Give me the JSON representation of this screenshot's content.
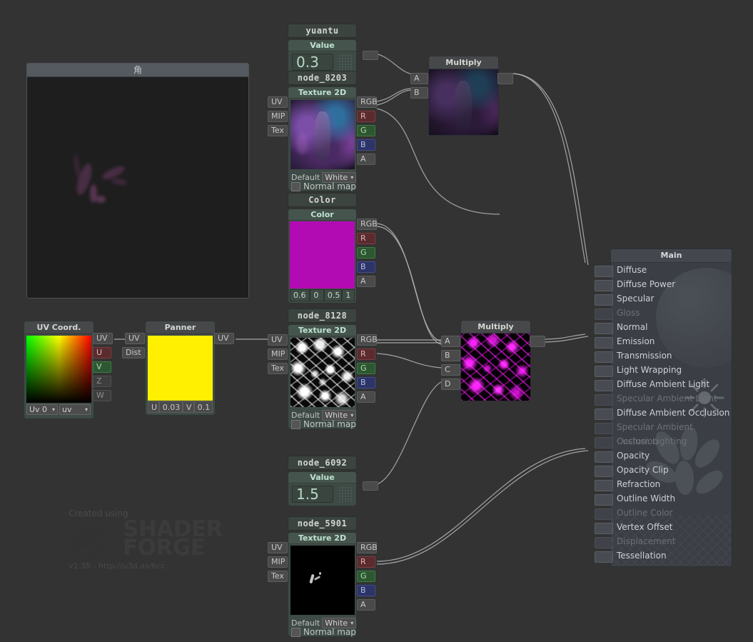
{
  "app": {
    "background": "#333333",
    "watermark": {
      "created_using": "Created using",
      "brand_line1": "SHADER",
      "brand_line2": "FORGE",
      "version": "v1.38 - http://u3d.as/6cc"
    }
  },
  "preview": {
    "title": "角"
  },
  "nodes": {
    "yuantu": {
      "title": "yuantu",
      "header": "Value",
      "value": "0.3"
    },
    "node_8203": {
      "title": "node_8203",
      "header": "Texture 2D",
      "inputs": [
        "UV",
        "MIP",
        "Tex"
      ],
      "outputs": [
        "RGB",
        "R",
        "G",
        "B",
        "A"
      ],
      "default_label": "Default",
      "default_value": "White",
      "normal_map_label": "Normal map"
    },
    "color": {
      "title": "Color",
      "header": "Color",
      "swatch": "#b30bb3",
      "outputs": [
        "RGB",
        "R",
        "G",
        "B",
        "A"
      ],
      "rgba": [
        "0.6",
        "0",
        "0.5",
        "1"
      ]
    },
    "uv_coord": {
      "title": "UV Coord.",
      "outputs": [
        "UV",
        "U",
        "V",
        "Z",
        "W"
      ],
      "select_channel": "Uv 0",
      "select_mode": "uv"
    },
    "panner": {
      "title": "Panner",
      "inputs": [
        "UV",
        "Dist"
      ],
      "outputs": [
        "UV"
      ],
      "u_label": "U",
      "u_value": "0.03",
      "v_label": "V",
      "v_value": "0.1"
    },
    "node_8128": {
      "title": "node_8128",
      "header": "Texture 2D",
      "inputs": [
        "UV",
        "MIP",
        "Tex"
      ],
      "outputs": [
        "RGB",
        "R",
        "G",
        "B",
        "A"
      ],
      "default_label": "Default",
      "default_value": "White",
      "normal_map_label": "Normal map"
    },
    "node_6092": {
      "title": "node_6092",
      "header": "Value",
      "value": "1.5"
    },
    "node_5901": {
      "title": "node_5901",
      "header": "Texture 2D",
      "inputs": [
        "UV",
        "MIP",
        "Tex"
      ],
      "outputs": [
        "RGB",
        "R",
        "G",
        "B",
        "A"
      ],
      "default_label": "Default",
      "default_value": "White",
      "normal_map_label": "Normal map"
    },
    "multiply_top": {
      "title": "Multiply",
      "inputs": [
        "A",
        "B"
      ]
    },
    "multiply_mid": {
      "title": "Multiply",
      "inputs": [
        "A",
        "B",
        "C",
        "D"
      ]
    }
  },
  "main_node": {
    "title": "Main",
    "properties": [
      {
        "label": "Diffuse",
        "enabled": true,
        "connected": true
      },
      {
        "label": "Diffuse Power",
        "enabled": true,
        "connected": false
      },
      {
        "label": "Specular",
        "enabled": true,
        "connected": false
      },
      {
        "label": "Gloss",
        "enabled": false,
        "connected": false
      },
      {
        "label": "Normal",
        "enabled": true,
        "connected": false
      },
      {
        "label": "Emission",
        "enabled": true,
        "connected": true
      },
      {
        "label": "Transmission",
        "enabled": true,
        "connected": false
      },
      {
        "label": "Light Wrapping",
        "enabled": true,
        "connected": false
      },
      {
        "label": "Diffuse Ambient Light",
        "enabled": true,
        "connected": false
      },
      {
        "label": "Specular Ambient Light",
        "enabled": false,
        "connected": false
      },
      {
        "label": "Diffuse Ambient Occlusion",
        "enabled": true,
        "connected": false
      },
      {
        "label": "Specular Ambient Occlusion",
        "enabled": false,
        "connected": false
      },
      {
        "label": "Custom Lighting",
        "enabled": false,
        "connected": false
      },
      {
        "label": "Opacity",
        "enabled": true,
        "connected": true
      },
      {
        "label": "Opacity Clip",
        "enabled": true,
        "connected": false
      },
      {
        "label": "Refraction",
        "enabled": true,
        "connected": false
      },
      {
        "label": "Outline Width",
        "enabled": true,
        "connected": false
      },
      {
        "label": "Outline Color",
        "enabled": false,
        "connected": false
      },
      {
        "label": "Vertex Offset",
        "enabled": true,
        "connected": false
      },
      {
        "label": "Displacement",
        "enabled": false,
        "connected": false
      },
      {
        "label": "Tessellation",
        "enabled": true,
        "connected": false
      }
    ]
  }
}
